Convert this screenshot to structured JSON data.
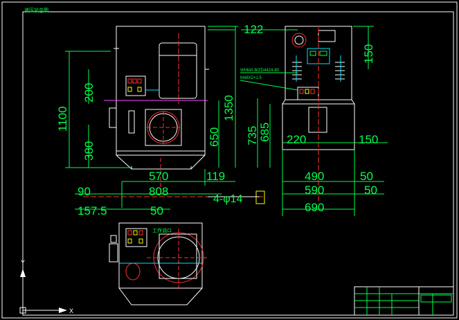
{
  "drawing": {
    "top_left_label": "液压站总图",
    "front_view_dims": {
      "width_122": "122",
      "height_150": "150",
      "height_1100": "1100",
      "height_200": "200",
      "height_1350": "1350",
      "height_650": "650",
      "height_380": "380",
      "width_570": "570",
      "width_119": "119",
      "width_90": "90",
      "width_808": "808",
      "width_157_5": "157.5",
      "width_50": "50",
      "bolt_holes": "4-φ14"
    },
    "side_view_dims": {
      "height_735": "735",
      "height_685": "685",
      "width_220": "220",
      "width_150": "150",
      "width_490": "490",
      "width_50a": "50",
      "width_590": "590",
      "width_50b": "50",
      "width_690": "690"
    },
    "annotations": {
      "valve_note_1": "WHMA B/ZD4424-80",
      "valve_note_2": "M48X2×1.5",
      "oil_port_label": "工作油口"
    }
  },
  "ucs": {
    "x_label": "X",
    "y_label": "Y"
  },
  "title_block": {
    "label": ""
  }
}
